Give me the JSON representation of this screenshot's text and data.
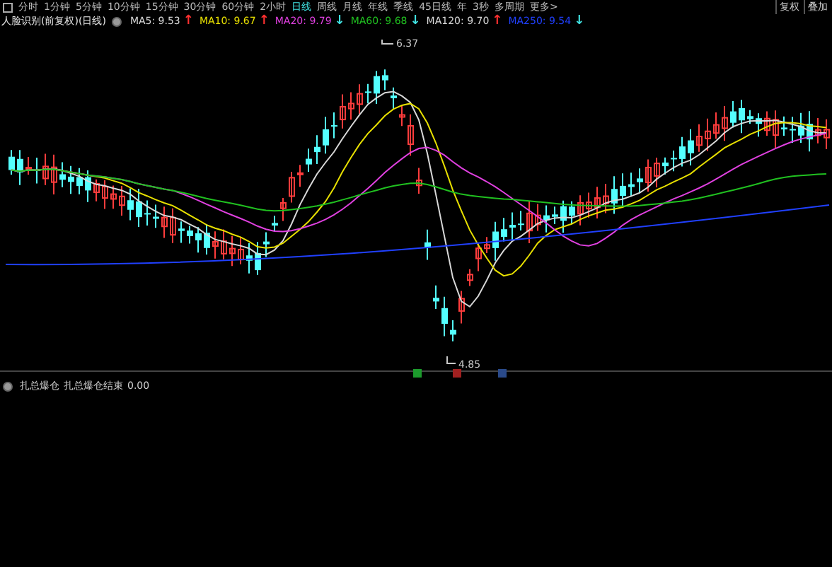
{
  "toolbar": {
    "periods": [
      {
        "label": "分时",
        "selected": false
      },
      {
        "label": "1分钟",
        "selected": false
      },
      {
        "label": "5分钟",
        "selected": false
      },
      {
        "label": "10分钟",
        "selected": false
      },
      {
        "label": "15分钟",
        "selected": false
      },
      {
        "label": "30分钟",
        "selected": false
      },
      {
        "label": "60分钟",
        "selected": false
      },
      {
        "label": "2小时",
        "selected": false
      },
      {
        "label": "日线",
        "selected": true
      },
      {
        "label": "周线",
        "selected": false
      },
      {
        "label": "月线",
        "selected": false
      },
      {
        "label": "年线",
        "selected": false
      },
      {
        "label": "季线",
        "selected": false
      },
      {
        "label": "45日线",
        "selected": false
      },
      {
        "label": "年",
        "selected": false
      },
      {
        "label": "3秒",
        "selected": false
      },
      {
        "label": "多周期",
        "selected": false
      },
      {
        "label": "更多>",
        "selected": false
      }
    ],
    "buttons": [
      "复权",
      "叠加"
    ]
  },
  "title": "人脸识别(前复权)(日线)",
  "indicators": [
    {
      "name": "MA5:",
      "value": "9.53",
      "arrow": {
        "text": "↑",
        "color": "#ff3030"
      },
      "color": "#d8d8d8"
    },
    {
      "name": "MA10:",
      "value": "9.67",
      "arrow": {
        "text": "↑",
        "color": "#ff3030"
      },
      "color": "#e8e000"
    },
    {
      "name": "MA20:",
      "value": "9.79",
      "arrow": {
        "text": "↓",
        "color": "#40e0e0"
      },
      "color": "#e040e0"
    },
    {
      "name": "MA60:",
      "value": "9.68",
      "arrow": {
        "text": "↓",
        "color": "#40e0e0"
      },
      "color": "#20c020"
    },
    {
      "name": "MA120:",
      "value": "9.70",
      "arrow": {
        "text": "↑",
        "color": "#ff3030"
      },
      "color": "#d8d8d8"
    },
    {
      "name": "MA250:",
      "value": "9.54",
      "arrow": {
        "text": "↓",
        "color": "#40e0e0"
      },
      "color": "#2040ff"
    }
  ],
  "chart": {
    "high_label": "6.37",
    "low_label": "4.85"
  },
  "lower_pane": {
    "indicator": "扎总爆仓",
    "line": "扎总爆仓结束",
    "value": "0.00"
  }
}
